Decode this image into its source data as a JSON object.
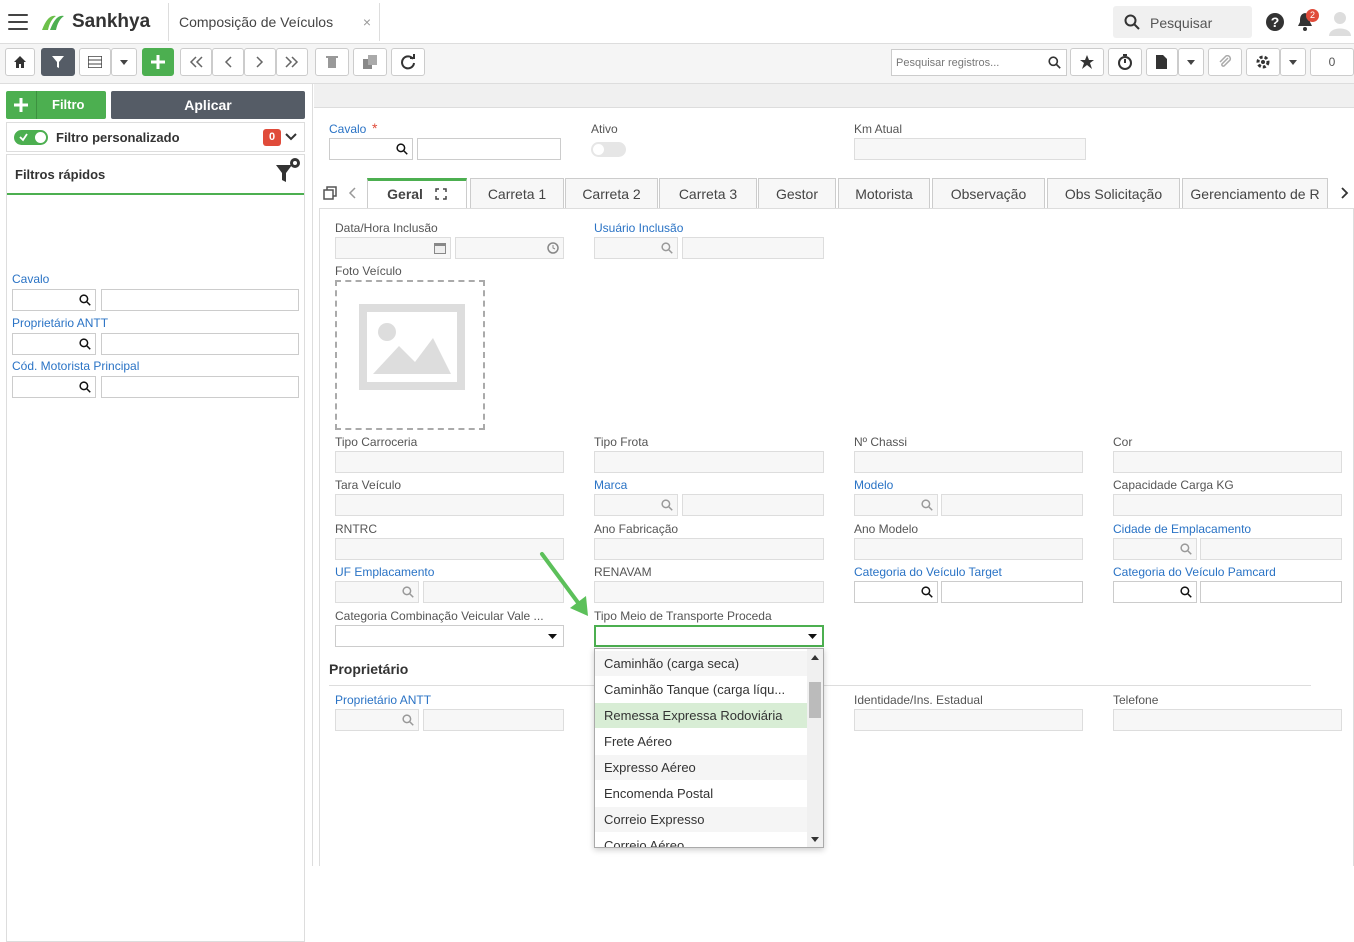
{
  "topbar": {
    "brand": "Sankhya",
    "tab_title": "Composição de Veículos",
    "close": "×",
    "search_label": "Pesquisar",
    "notif_count": "2"
  },
  "toolbar": {
    "search_placeholder": "Pesquisar registros...",
    "counter": "0"
  },
  "sidebar": {
    "filtro_label": "Filtro",
    "aplicar_label": "Aplicar",
    "filtro_personalizado": "Filtro personalizado",
    "filtro_count": "0",
    "filtros_rapidos": "Filtros rápidos",
    "fields": [
      "Cavalo",
      "Proprietário ANTT",
      "Cód. Motorista Principal"
    ]
  },
  "header": {
    "cavalo": "Cavalo",
    "required": "*",
    "ativo": "Ativo",
    "km_atual": "Km Atual"
  },
  "tabs": [
    "Geral",
    "Carreta 1",
    "Carreta 2",
    "Carreta 3",
    "Gestor",
    "Motorista",
    "Observação",
    "Obs Solicitação",
    "Gerenciamento de R"
  ],
  "form": {
    "data_hora": "Data/Hora Inclusão",
    "usuario": "Usuário Inclusão",
    "foto": "Foto Veículo",
    "tipo_carroceria": "Tipo Carroceria",
    "tipo_frota": "Tipo Frota",
    "n_chassi": "Nº Chassi",
    "cor": "Cor",
    "tara": "Tara Veículo",
    "marca": "Marca",
    "modelo": "Modelo",
    "capacidade": "Capacidade Carga KG",
    "rntrc": "RNTRC",
    "ano_fab": "Ano Fabricação",
    "ano_modelo": "Ano Modelo",
    "cidade_emp": "Cidade de Emplacamento",
    "uf_emp": "UF Emplacamento",
    "renavam": "RENAVAM",
    "cat_target": "Categoria do Veículo Target",
    "cat_pamcard": "Categoria do Veículo Pamcard",
    "cat_comb": "Categoria Combinação Veicular Vale ...",
    "tipo_meio": "Tipo Meio de Transporte Proceda"
  },
  "proprietario": {
    "title": "Proprietário",
    "antt": "Proprietário ANTT",
    "identidade": "Identidade/Ins. Estadual",
    "telefone": "Telefone"
  },
  "dropdown": {
    "options": [
      "Caminhão (carga seca)",
      "Caminhão Tanque (carga líqu...",
      "Remessa Expressa Rodoviária",
      "Frete Aéreo",
      "Expresso Aéreo",
      "Encomenda Postal",
      "Correio Expresso",
      "Correio Aéreo"
    ],
    "selected_index": 2
  },
  "colors": {
    "accent": "#4caf50",
    "link": "#2a73c5",
    "dark_button": "#555c66",
    "badge": "#e04b3a"
  }
}
